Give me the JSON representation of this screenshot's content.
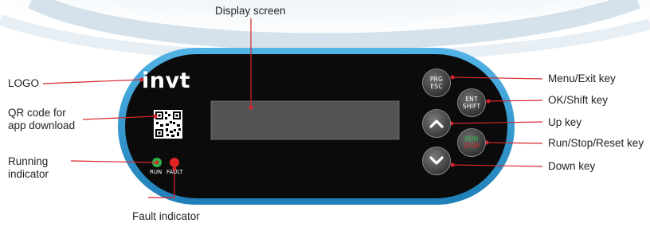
{
  "colors": {
    "bezel": "#2f9bd4",
    "panel": "#0b0b0b",
    "screen": "#545454",
    "pointer": "#d6262b",
    "run_led": "#2fb34a",
    "fault_led": "#e02424"
  },
  "panel": {
    "logo_text": "invt",
    "led_run_label": "RUN",
    "led_fault_label": "FAULT",
    "keys": {
      "prg_top": "PRG",
      "prg_bottom": "ESC",
      "ent_top": "ENT",
      "ent_bottom": "SHIFT",
      "run_top": "RUN",
      "run_bottom": "STOP",
      "up_icon": "chevron-up-icon",
      "down_icon": "chevron-down-icon"
    }
  },
  "callouts": {
    "display_screen": "Display screen",
    "logo": "LOGO",
    "qr_line1": "QR code for",
    "qr_line2": "app download",
    "running_line1": "Running",
    "running_line2": "indicator",
    "fault_indicator": "Fault indicator",
    "menu_exit": "Menu/Exit key",
    "ok_shift": "OK/Shift key",
    "up_key": "Up key",
    "run_stop_reset": "Run/Stop/Reset key",
    "down_key": "Down key"
  }
}
